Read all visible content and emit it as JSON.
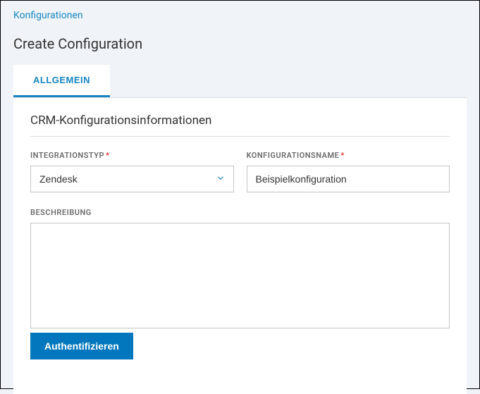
{
  "breadcrumb": {
    "label": "Konfigurationen"
  },
  "page_title": "Create Configuration",
  "tabs": {
    "general": "ALLGEMEIN"
  },
  "section": {
    "title": "CRM-Konfigurationsinformationen"
  },
  "fields": {
    "integration_type": {
      "label": "INTEGRATIONSTYP",
      "value": "Zendesk"
    },
    "config_name": {
      "label": "KONFIGURATIONSNAME",
      "value": "Beispielkonfiguration"
    },
    "description": {
      "label": "BESCHREIBUNG",
      "value": ""
    }
  },
  "buttons": {
    "authenticate": "Authentifizieren"
  },
  "required_marker": "*"
}
